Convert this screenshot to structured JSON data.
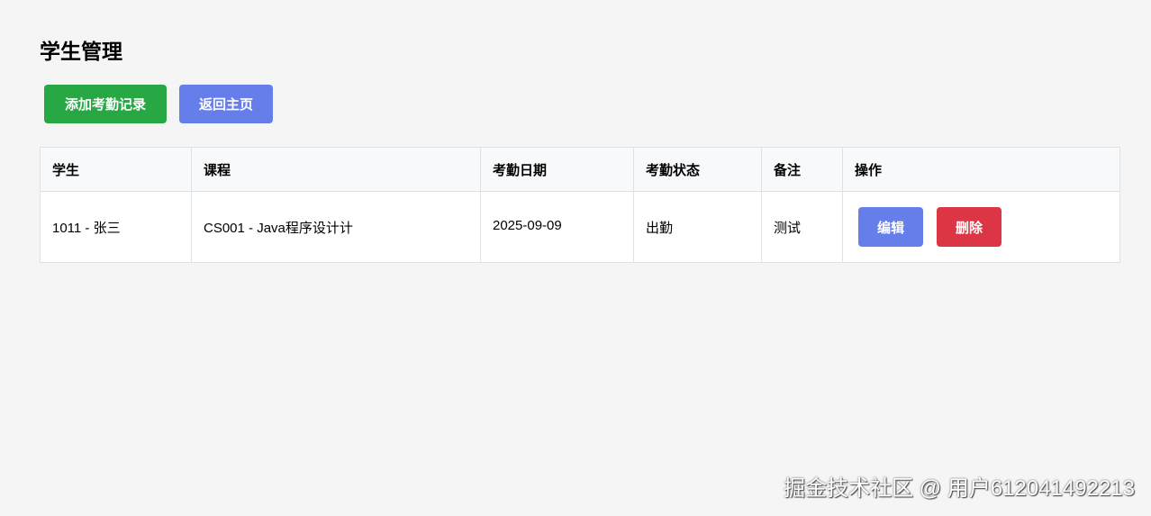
{
  "page_title": "学生管理",
  "toolbar": {
    "add_label": "添加考勤记录",
    "home_label": "返回主页"
  },
  "table": {
    "headers": [
      "学生",
      "课程",
      "考勤日期",
      "考勤状态",
      "备注",
      "操作"
    ],
    "rows": [
      {
        "student": "1011 - 张三",
        "course": "CS001 - Java程序设计计",
        "date": "2025-09-09",
        "status": "出勤",
        "note": "测试",
        "edit_label": "编辑",
        "delete_label": "删除"
      }
    ]
  },
  "watermark": "掘金技术社区 @ 用户612041492213",
  "colors": {
    "green": "#28a745",
    "blue": "#667eea",
    "red": "#dc3545"
  }
}
